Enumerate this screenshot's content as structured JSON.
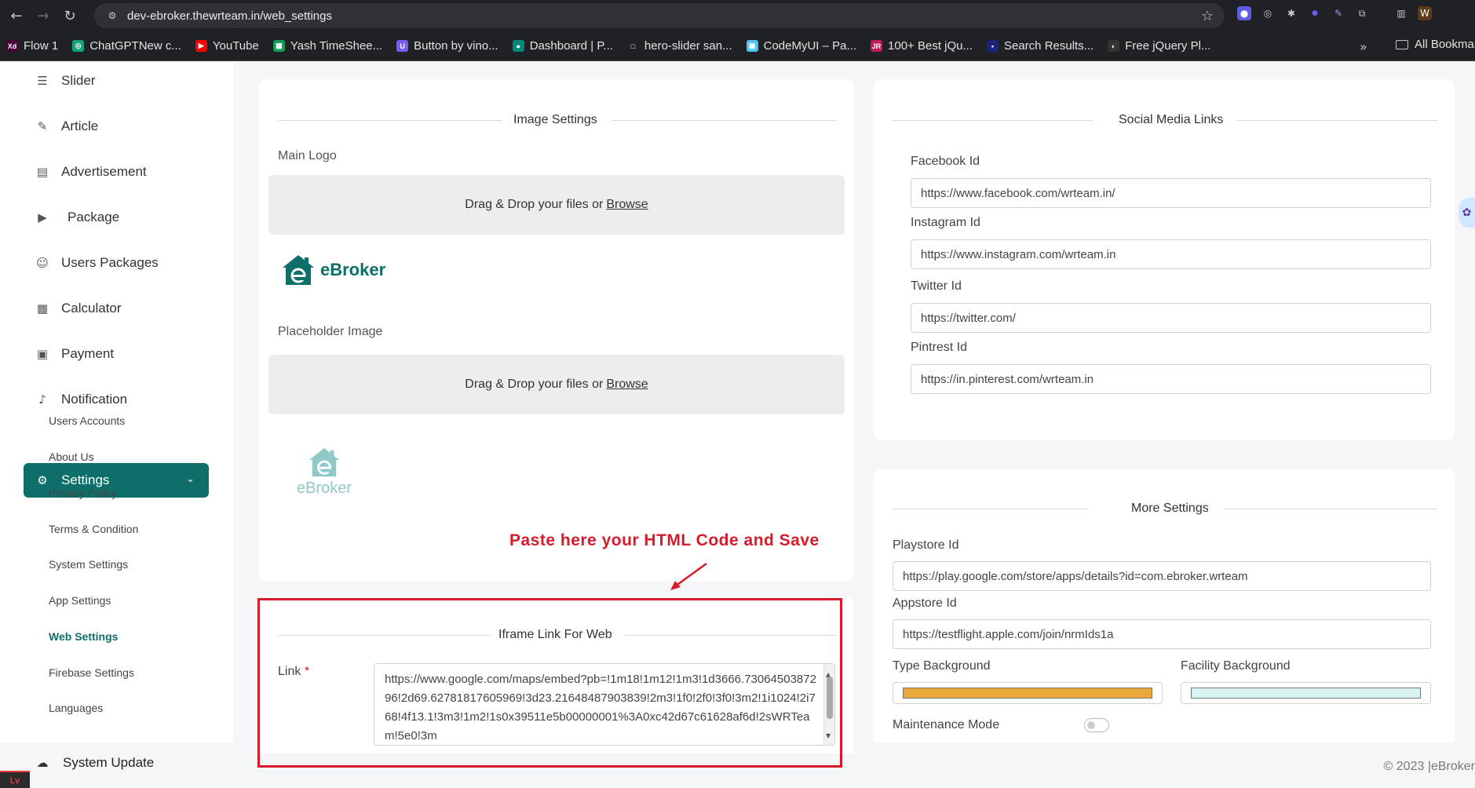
{
  "browser": {
    "url": "dev-ebroker.thewrteam.in/web_settings",
    "bookmarks": [
      {
        "label": "Flow 1",
        "icon": "xd-icon",
        "color": "#470137",
        "glyph": "Xd"
      },
      {
        "label": "ChatGPTNew c...",
        "icon": "chatgpt-icon",
        "color": "#10a37f",
        "glyph": "◎"
      },
      {
        "label": "YouTube",
        "icon": "youtube-icon",
        "color": "#ff0000",
        "glyph": "▶"
      },
      {
        "label": "Yash TimeShee...",
        "icon": "sheets-icon",
        "color": "#0f9d58",
        "glyph": "▦"
      },
      {
        "label": "Button by vino...",
        "icon": "uiverse-icon",
        "color": "#7a5af8",
        "glyph": "U"
      },
      {
        "label": "Dashboard | P...",
        "icon": "dashboard-icon",
        "color": "#00897b",
        "glyph": "●"
      },
      {
        "label": "hero-slider san...",
        "icon": "page-icon",
        "color": "#202124",
        "glyph": "□"
      },
      {
        "label": "CodeMyUI – Pa...",
        "icon": "codemyui-icon",
        "color": "#4fc3f7",
        "glyph": "▣"
      },
      {
        "label": "100+ Best jQu...",
        "icon": "jqueryscript-icon",
        "color": "#c2185b",
        "glyph": "JR"
      },
      {
        "label": "Search Results...",
        "icon": "search-results-icon",
        "color": "#1a237e",
        "glyph": "▪"
      },
      {
        "label": "Free jQuery Pl...",
        "icon": "jquery-icon",
        "color": "#333333",
        "glyph": "◐"
      }
    ],
    "all_bookmarks": "All Bookmarks"
  },
  "sidebar": {
    "items": [
      {
        "label": "Slider",
        "icon": "sliders-icon",
        "glyph": "☰"
      },
      {
        "label": "Article",
        "icon": "pen-icon",
        "glyph": "✎"
      },
      {
        "label": "Advertisement",
        "icon": "ad-icon",
        "glyph": "▤"
      },
      {
        "label": "Package",
        "icon": "package-icon",
        "glyph": "▶"
      },
      {
        "label": "Users Packages",
        "icon": "user-icon",
        "glyph": "☺"
      },
      {
        "label": "Calculator",
        "icon": "calculator-icon",
        "glyph": "▦"
      },
      {
        "label": "Payment",
        "icon": "payment-icon",
        "glyph": "▣"
      },
      {
        "label": "Notification",
        "icon": "bell-icon",
        "glyph": "♪"
      }
    ],
    "settings_label": "Settings",
    "sub_items": [
      "Users Accounts",
      "About Us",
      "Privacy Policy",
      "Terms & Condition",
      "System Settings",
      "App Settings",
      "Web Settings",
      "Firebase Settings",
      "Languages"
    ],
    "active_sub": "Web Settings",
    "system_update": "System Update"
  },
  "image_settings": {
    "title": "Image Settings",
    "main_logo_label": "Main Logo",
    "placeholder_label": "Placeholder Image",
    "dropzone_text": "Drag & Drop your files or",
    "browse": "Browse",
    "logo_text": "eBroker",
    "brand_color": "#0e6e6a"
  },
  "iframe": {
    "title": "Iframe Link For Web",
    "link_label": "Link",
    "required_mark": "*",
    "link_value": "https://www.google.com/maps/embed?pb=!1m18!1m12!1m3!1d3666.7306450387296!2d69.62781817605969!3d23.21648487903839!2m3!1f0!2f0!3f0!3m2!1i1024!2i768!4f13.1!3m3!1m2!1s0x39511e5b00000001%3A0xc42d67c61628af6d!2sWRTeam!5e0!3m"
  },
  "annotation": "Paste here your HTML Code and Save",
  "social": {
    "title": "Social Media Links",
    "facebook_label": "Facebook Id",
    "facebook_value": "https://www.facebook.com/wrteam.in/",
    "instagram_label": "Instagram Id",
    "instagram_value": "https://www.instagram.com/wrteam.in",
    "twitter_label": "Twitter Id",
    "twitter_value": "https://twitter.com/",
    "pinterest_label": "Pintrest Id",
    "pinterest_value": "https://in.pinterest.com/wrteam.in"
  },
  "more": {
    "title": "More Settings",
    "playstore_label": "Playstore Id",
    "playstore_value": "https://play.google.com/store/apps/details?id=com.ebroker.wrteam",
    "appstore_label": "Appstore Id",
    "appstore_value": "https://testflight.apple.com/join/nrmIds1a",
    "type_bg_label": "Type Background",
    "type_bg_color": "#e8a93a",
    "facility_bg_label": "Facility Background",
    "facility_bg_color": "#d7f4f2",
    "maintenance_label": "Maintenance Mode",
    "maintenance_on": false
  },
  "footer": "© 2023 |eBroker"
}
